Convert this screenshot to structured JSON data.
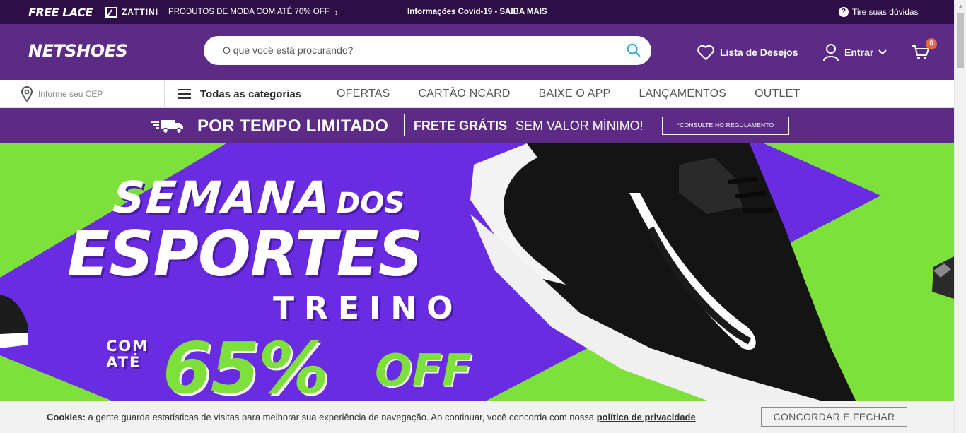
{
  "topbar": {
    "freelace_logo": "FREE LACE",
    "zattini_logo": "ZATTINI",
    "promo_text": "PRODUTOS DE MODA COM ATÉ 70% OFF",
    "covid_text": "Informações Covid-19 - SAIBA MAIS",
    "help_text": "Tire suas dúvidas"
  },
  "header": {
    "logo": "NETSHOES",
    "search_placeholder": "O que você está procurando?",
    "wishlist_label": "Lista de Desejos",
    "login_label": "Entrar",
    "cart_count": "0"
  },
  "nav": {
    "cep_placeholder": "Informe seu CEP",
    "all_categories": "Todas as categorias",
    "links": [
      "OFERTAS",
      "CARTÃO NCARD",
      "BAIXE O APP",
      "LANÇAMENTOS",
      "OUTLET"
    ]
  },
  "promo_bar": {
    "title": "POR TEMPO LIMITADO",
    "free_shipping": "FRETE GRÁTIS",
    "no_minimum": "SEM VALOR MÍNIMO!",
    "rule_button": "*CONSULTE NO REGULAMENTO"
  },
  "hero": {
    "line1": "SEMANA",
    "line1b": "DOS",
    "line2": "ESPORTES",
    "line3": "TREINO",
    "com": "COM",
    "ate": "ATÉ",
    "percent": "65%",
    "off": "OFF"
  },
  "cookie": {
    "label": "Cookies:",
    "text": " a gente guarda estatísticas de visitas para melhorar sua experiência de navegação. Ao continuar, você concorda com nossa ",
    "link": "política de privacidade",
    "end": ".",
    "button": "CONCORDAR E FECHAR"
  },
  "colors": {
    "top_strip": "#2e0f45",
    "brand_purple": "#5c2b86",
    "hero_purple": "#6a2ce0",
    "hero_green": "#7ee03a",
    "cart_badge": "#f2653a",
    "search_icon": "#2aa6d6"
  }
}
